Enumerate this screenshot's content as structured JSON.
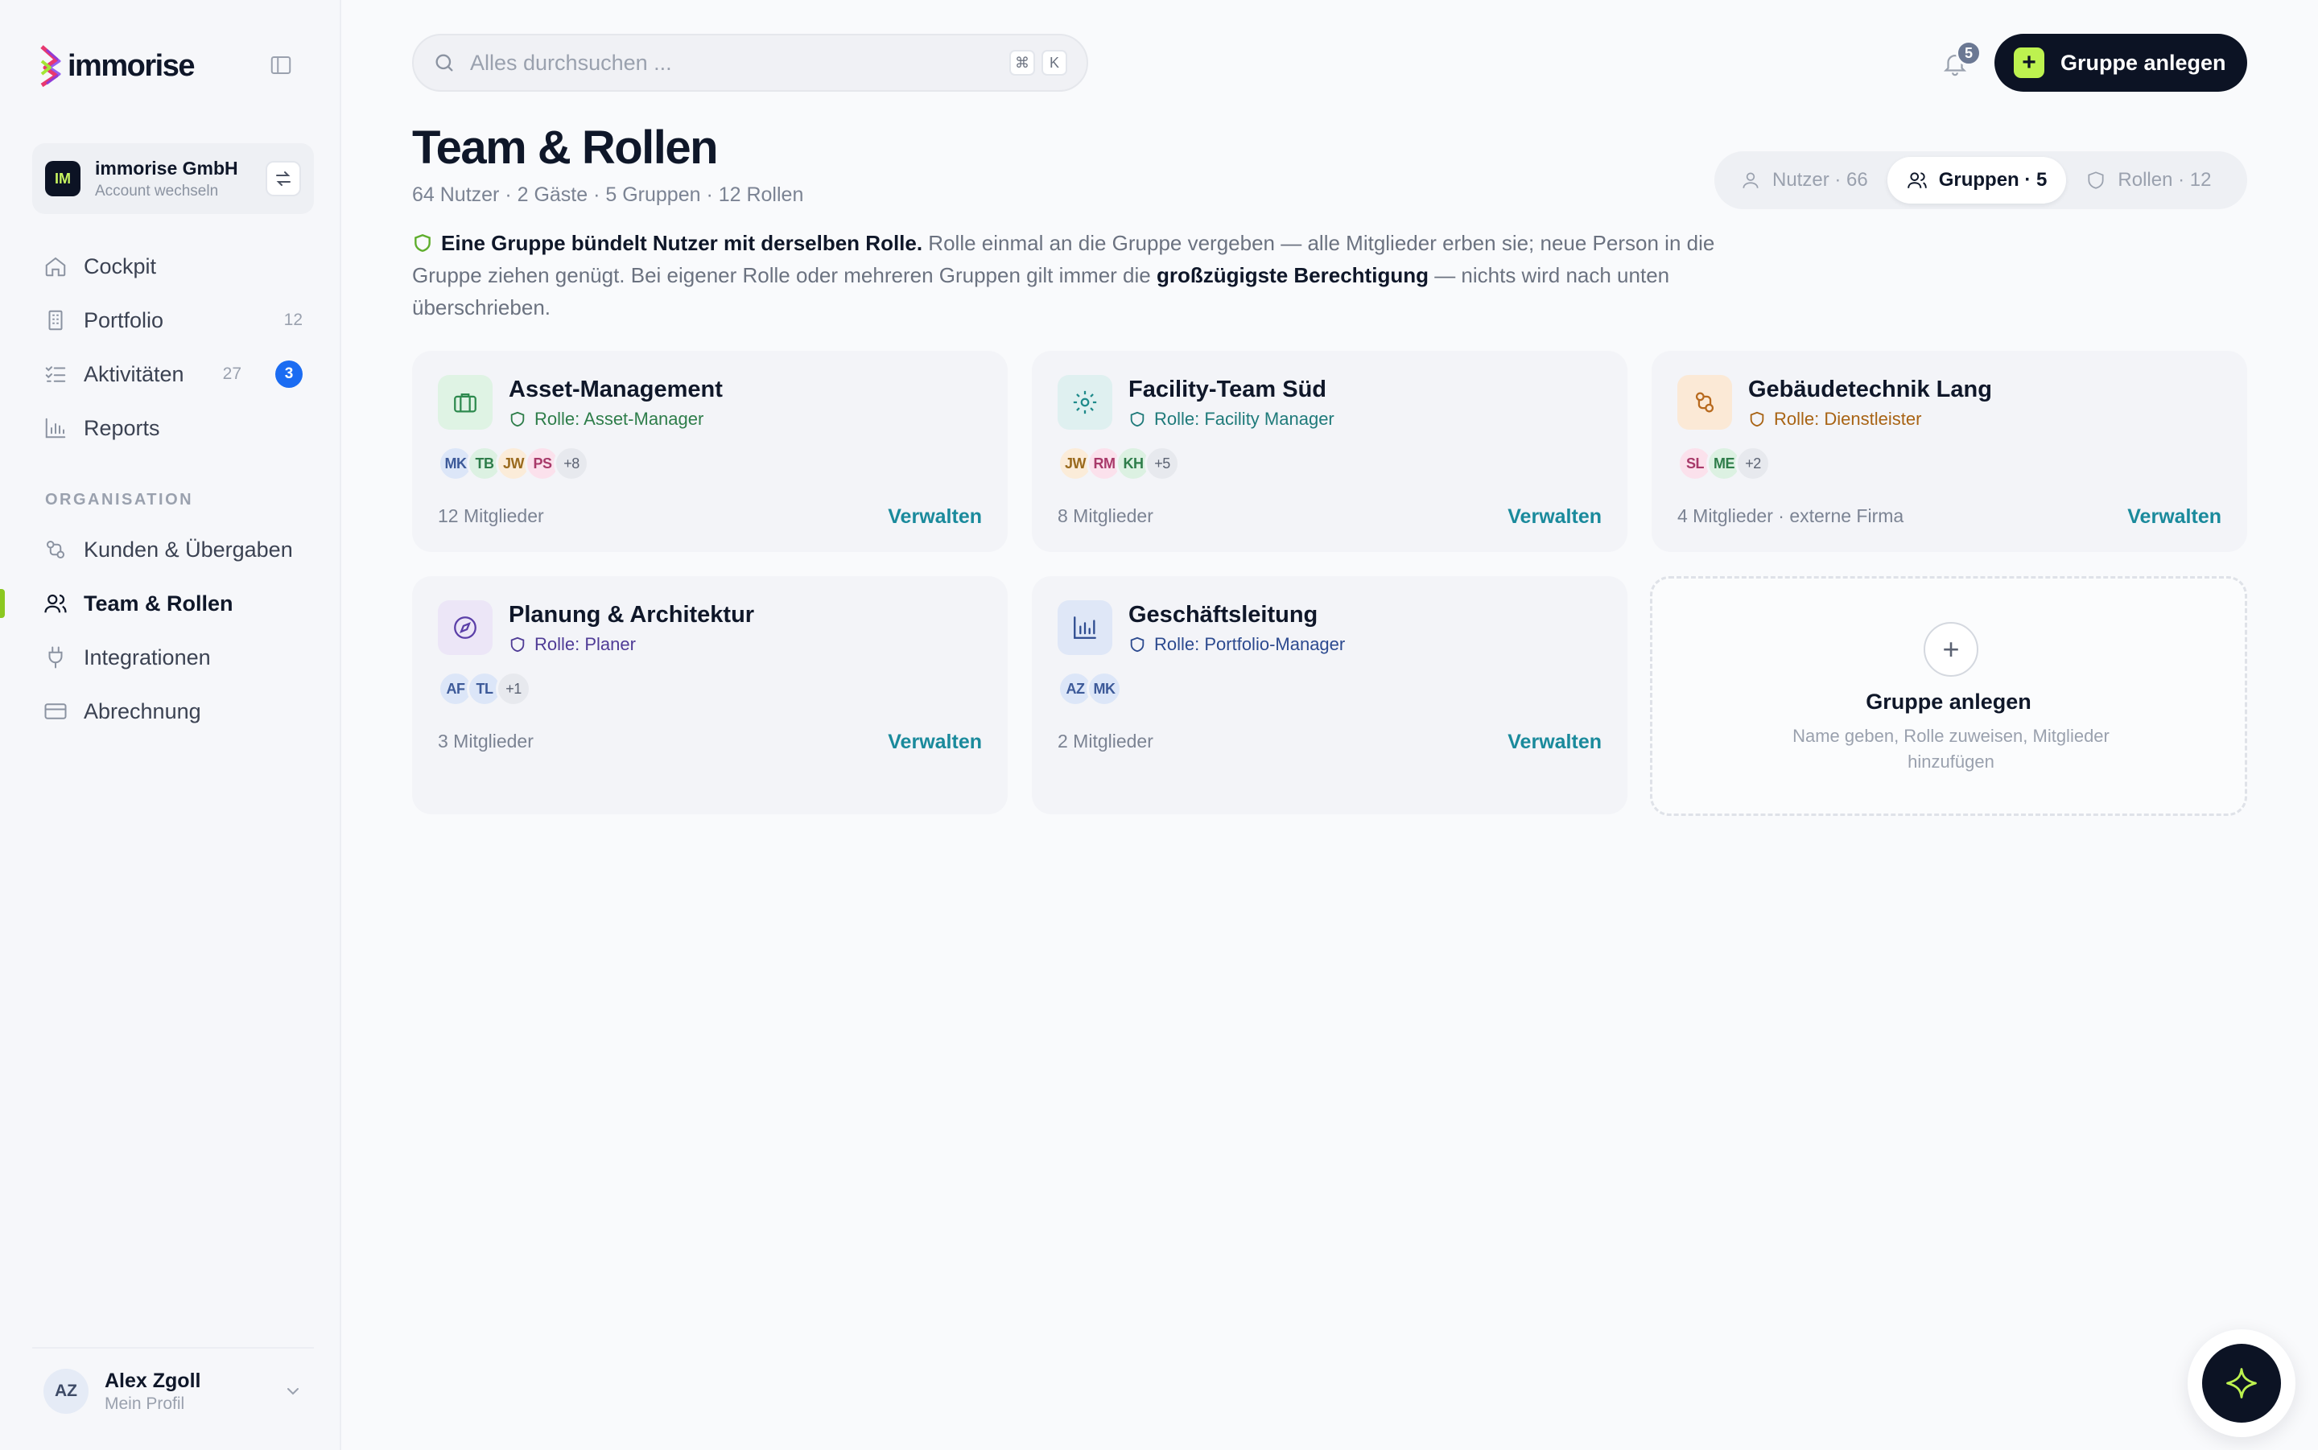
{
  "app": {
    "logo": "immorise"
  },
  "account": {
    "initials": "IM",
    "name": "immorise GmbH",
    "sub": "Account wechseln"
  },
  "nav": {
    "main": [
      {
        "label": "Cockpit",
        "icon": "home-icon"
      },
      {
        "label": "Portfolio",
        "count": "12",
        "icon": "building-icon"
      },
      {
        "label": "Aktivitäten",
        "count": "27",
        "badge": "3",
        "icon": "checklist-icon"
      },
      {
        "label": "Reports",
        "icon": "chart-icon"
      }
    ],
    "section_label": "ORGANISATION",
    "org": [
      {
        "label": "Kunden & Übergaben",
        "icon": "handover-icon"
      },
      {
        "label": "Team & Rollen",
        "icon": "users-icon",
        "active": true
      },
      {
        "label": "Integrationen",
        "icon": "plug-icon"
      },
      {
        "label": "Abrechnung",
        "icon": "card-icon"
      }
    ]
  },
  "profile": {
    "initials": "AZ",
    "name": "Alex Zgoll",
    "sub": "Mein Profil"
  },
  "search": {
    "placeholder": "Alles durchsuchen ...",
    "value": "",
    "kbd1": "⌘",
    "kbd2": "K"
  },
  "notifications": {
    "count": "5"
  },
  "primary_action": {
    "label": "Gruppe anlegen",
    "plus": "+"
  },
  "page": {
    "title": "Team & Rollen",
    "subtitle": "64 Nutzer · 2 Gäste · 5 Gruppen · 12 Rollen",
    "info": {
      "lead": "Eine Gruppe bündelt Nutzer mit derselben Rolle.",
      "mid": " Rolle einmal an die Gruppe vergeben — alle Mitglieder erben sie; neue Person in die Gruppe ziehen genügt. Bei eigener Rolle oder mehreren Gruppen gilt immer die ",
      "strong": "großzügigste Berechtigung",
      "tail": " — nichts wird nach unten überschrieben."
    }
  },
  "tabs": [
    {
      "label": "Nutzer · 66",
      "icon": "user-icon"
    },
    {
      "label": "Gruppen · 5",
      "icon": "users-icon",
      "active": true
    },
    {
      "label": "Rollen · 12",
      "icon": "shield-icon"
    }
  ],
  "groups": [
    {
      "name": "Asset-Management",
      "role": "Rolle: Asset-Manager",
      "members": "12 Mitglieder",
      "action": "Verwalten",
      "avatars": [
        "MK",
        "TB",
        "JW",
        "PS"
      ],
      "more": "+8",
      "icon": "briefcase-icon"
    },
    {
      "name": "Facility-Team Süd",
      "role": "Rolle: Facility Manager",
      "members": "8 Mitglieder",
      "action": "Verwalten",
      "avatars": [
        "JW",
        "RM",
        "KH"
      ],
      "more": "+5",
      "icon": "gear-icon"
    },
    {
      "name": "Gebäudetechnik Lang",
      "role": "Rolle: Dienstleister",
      "members": "4 Mitglieder · externe Firma",
      "action": "Verwalten",
      "avatars": [
        "SL",
        "ME"
      ],
      "more": "+2",
      "icon": "people-icon"
    },
    {
      "name": "Planung & Architektur",
      "role": "Rolle: Planer",
      "members": "3 Mitglieder",
      "action": "Verwalten",
      "avatars": [
        "AF",
        "TL"
      ],
      "more": "+1",
      "icon": "compass-icon"
    },
    {
      "name": "Geschäftsleitung",
      "role": "Rolle: Portfolio-Manager",
      "members": "2 Mitglieder",
      "action": "Verwalten",
      "avatars": [
        "AZ",
        "MK"
      ],
      "more": "",
      "icon": "bar-chart-icon"
    }
  ],
  "add_card": {
    "plus": "+",
    "title": "Gruppe anlegen",
    "desc": "Name geben, Rolle zuweisen, Mitglieder hinzufügen"
  },
  "colors": {
    "accent": "#bdf24f",
    "dark": "#0c1324",
    "link": "#1a8a9c",
    "badge": "#1b6cf2"
  }
}
